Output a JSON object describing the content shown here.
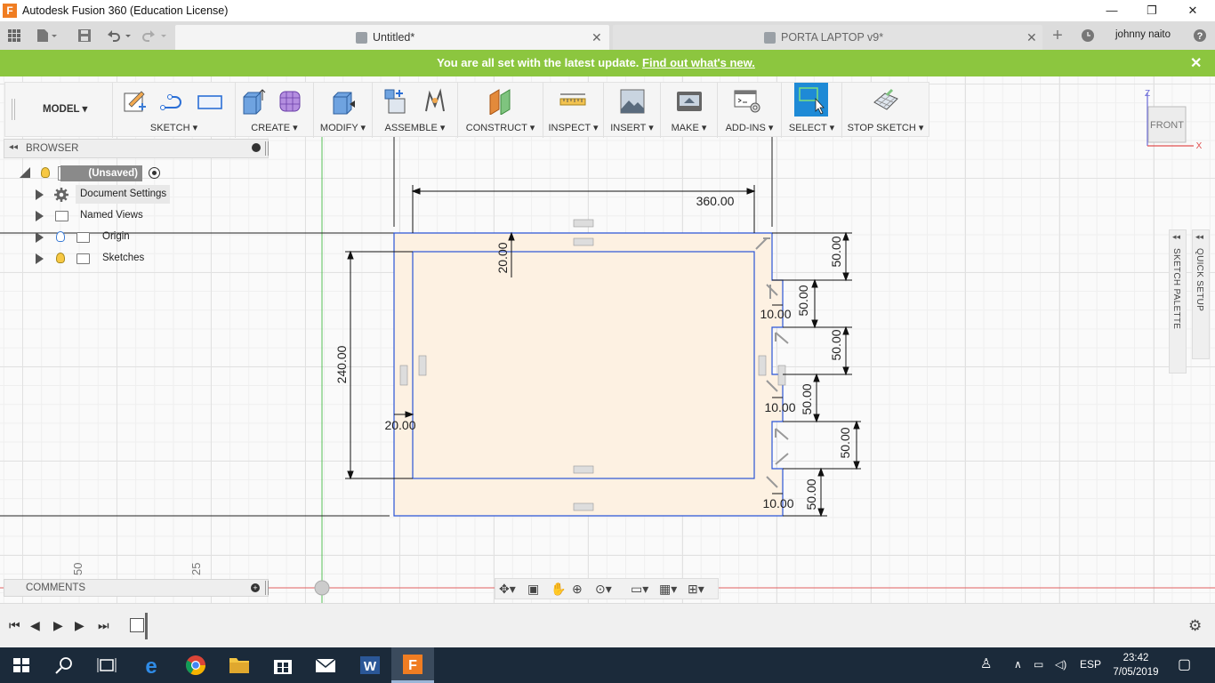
{
  "window": {
    "title": "Autodesk Fusion 360 (Education License)",
    "controls": [
      "—",
      "❐",
      "✕"
    ]
  },
  "tabs": [
    {
      "label": "Untitled*",
      "active": true
    },
    {
      "label": "PORTA LAPTOP v9*",
      "active": false
    }
  ],
  "user": {
    "name": "johnny naito"
  },
  "banner": {
    "message": "You are all set with the latest update.",
    "link": "Find out what's new.",
    "color": "#8cc63f"
  },
  "toolbar": {
    "workspace": "MODEL",
    "groups": [
      {
        "label": "SKETCH"
      },
      {
        "label": "CREATE"
      },
      {
        "label": "MODIFY"
      },
      {
        "label": "ASSEMBLE"
      },
      {
        "label": "CONSTRUCT"
      },
      {
        "label": "INSPECT"
      },
      {
        "label": "INSERT"
      },
      {
        "label": "MAKE"
      },
      {
        "label": "ADD-INS"
      },
      {
        "label": "SELECT"
      },
      {
        "label": "STOP SKETCH"
      }
    ],
    "dropdown_symbol": "▾"
  },
  "browser": {
    "title": "BROWSER",
    "root": "(Unsaved)",
    "items": [
      {
        "label": "Document Settings",
        "icon": "gear-icon"
      },
      {
        "label": "Named Views",
        "icon": "folder-icon"
      },
      {
        "label": "Origin",
        "icon": "folder-icon"
      },
      {
        "label": "Sketches",
        "icon": "folder-icon"
      }
    ]
  },
  "viewcube": {
    "face": "FRONT",
    "axis_z": "Z",
    "axis_x": "X"
  },
  "palettes": {
    "sketch": "SKETCH PALETTE",
    "quick": "QUICK SETUP"
  },
  "sketch": {
    "dimensions": {
      "width": "360.00",
      "height": "240.00",
      "top_offset": "20.00",
      "left_offset": "20.00",
      "right_a": "50.00",
      "right_b": "50.00",
      "right_c": "50.00",
      "right_d": "50.00",
      "right_e": "50.00",
      "right_f": "50.00",
      "tab_a": "10.00",
      "tab_b": "10.00",
      "tab_c": "10.00"
    },
    "ruler": [
      "50",
      "25"
    ],
    "colors": {
      "fill": "#fdf1e2",
      "line": "#2b55d6",
      "axis_red": "#e06060",
      "axis_green": "#55c055"
    }
  },
  "comments": {
    "title": "COMMENTS"
  },
  "taskbar": {
    "apps": [
      "windows-icon",
      "search-icon",
      "task-view-icon",
      "edge-icon",
      "chrome-icon",
      "explorer-icon",
      "store-icon",
      "mail-icon",
      "word-icon",
      "fusion-icon"
    ],
    "language": "ESP",
    "time": "23:42",
    "date": "7/05/2019"
  }
}
